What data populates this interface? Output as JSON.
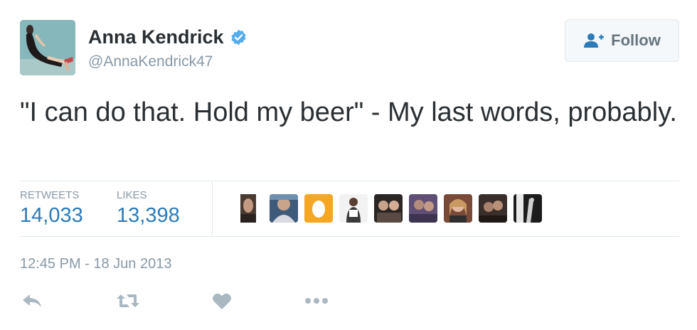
{
  "user": {
    "name": "Anna Kendrick",
    "handle": "@AnnaKendrick47",
    "verified_icon": "verified-badge-icon"
  },
  "follow_button": {
    "label": "Follow",
    "icon": "add-user-icon"
  },
  "tweet": {
    "text": "\"I can do that. Hold my beer\" - My last words, probably.",
    "timestamp": "12:45 PM - 18 Jun 2013"
  },
  "stats": {
    "retweets_label": "RETWEETS",
    "retweets_value": "14,033",
    "likes_label": "LIKES",
    "likes_value": "13,398"
  },
  "likers_count_shown": 9,
  "actions": [
    {
      "name": "reply-icon"
    },
    {
      "name": "retweet-icon"
    },
    {
      "name": "like-heart-icon"
    },
    {
      "name": "more-options-icon"
    }
  ],
  "colors": {
    "text": "#292f33",
    "muted": "#8899a6",
    "link_blue": "#2b7bb9",
    "verified_blue": "#55acee",
    "border": "#e1e8ed"
  }
}
